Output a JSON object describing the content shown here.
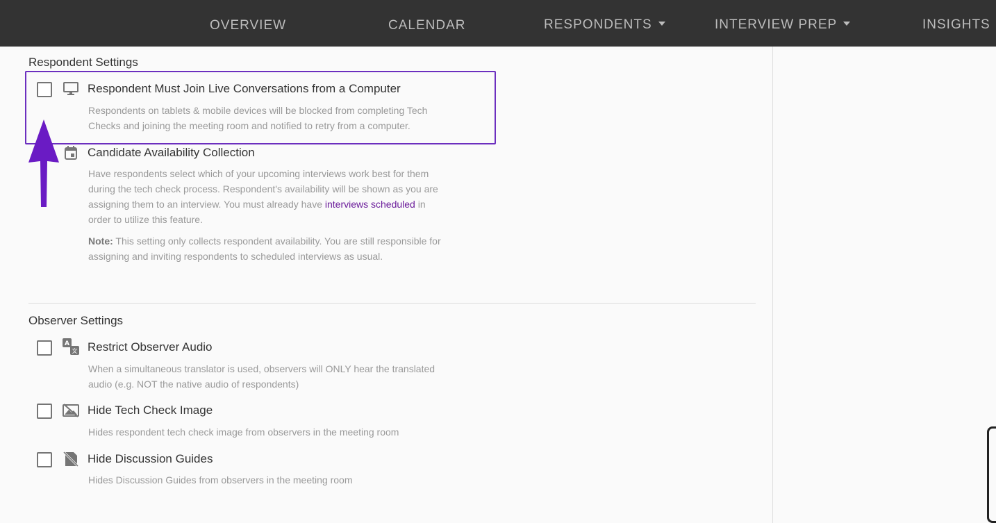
{
  "nav": {
    "overview": "OVERVIEW",
    "calendar": "CALENDAR",
    "respondents": "RESPONDENTS",
    "interview_prep": "INTERVIEW PREP",
    "insights": "INSIGHTS"
  },
  "respondent_settings": {
    "title": "Respondent Settings",
    "computer": {
      "icon": "monitor-icon",
      "label": "Respondent Must Join Live Conversations from a Computer",
      "desc1": "Respondents on tablets & mobile devices will be blocked from completing Tech",
      "desc2": "Checks and joining the meeting room and notified to retry from a computer.",
      "checked": false
    },
    "availability": {
      "icon": "calendar-icon",
      "label": "Candidate Availability Collection",
      "desc1": "Have respondents select which of your upcoming interviews work best for them",
      "desc2": "during the tech check process. Respondent's availability will be shown as you are",
      "desc3_pre": "assigning them to an interview. You must already have ",
      "desc3_link": "interviews scheduled",
      "desc3_post": " in",
      "desc4": "order to utilize this feature.",
      "note_label": "Note:",
      "note1": " This setting only collects respondent availability. You are still responsible for",
      "note2": "assigning and inviting respondents to scheduled interviews as usual."
    }
  },
  "observer_settings": {
    "title": "Observer Settings",
    "audio": {
      "icon": "translate-icon",
      "label": "Restrict Observer Audio",
      "desc1": "When a simultaneous translator is used, observers will ONLY hear the translated",
      "desc2": "audio (e.g. NOT the native audio of respondents)",
      "checked": false
    },
    "tech_image": {
      "icon": "hide-image-icon",
      "label": "Hide Tech Check Image",
      "desc1": "Hides respondent tech check image from observers in the meeting room",
      "checked": false
    },
    "guides": {
      "icon": "hide-document-icon",
      "label": "Hide Discussion Guides",
      "desc1": "Hides Discussion Guides from observers in the meeting room",
      "checked": false
    }
  },
  "colors": {
    "nav_bg": "#333333",
    "highlight": "#6c2fbf",
    "arrow": "#6a1bc4",
    "link": "#6a1b9a"
  }
}
